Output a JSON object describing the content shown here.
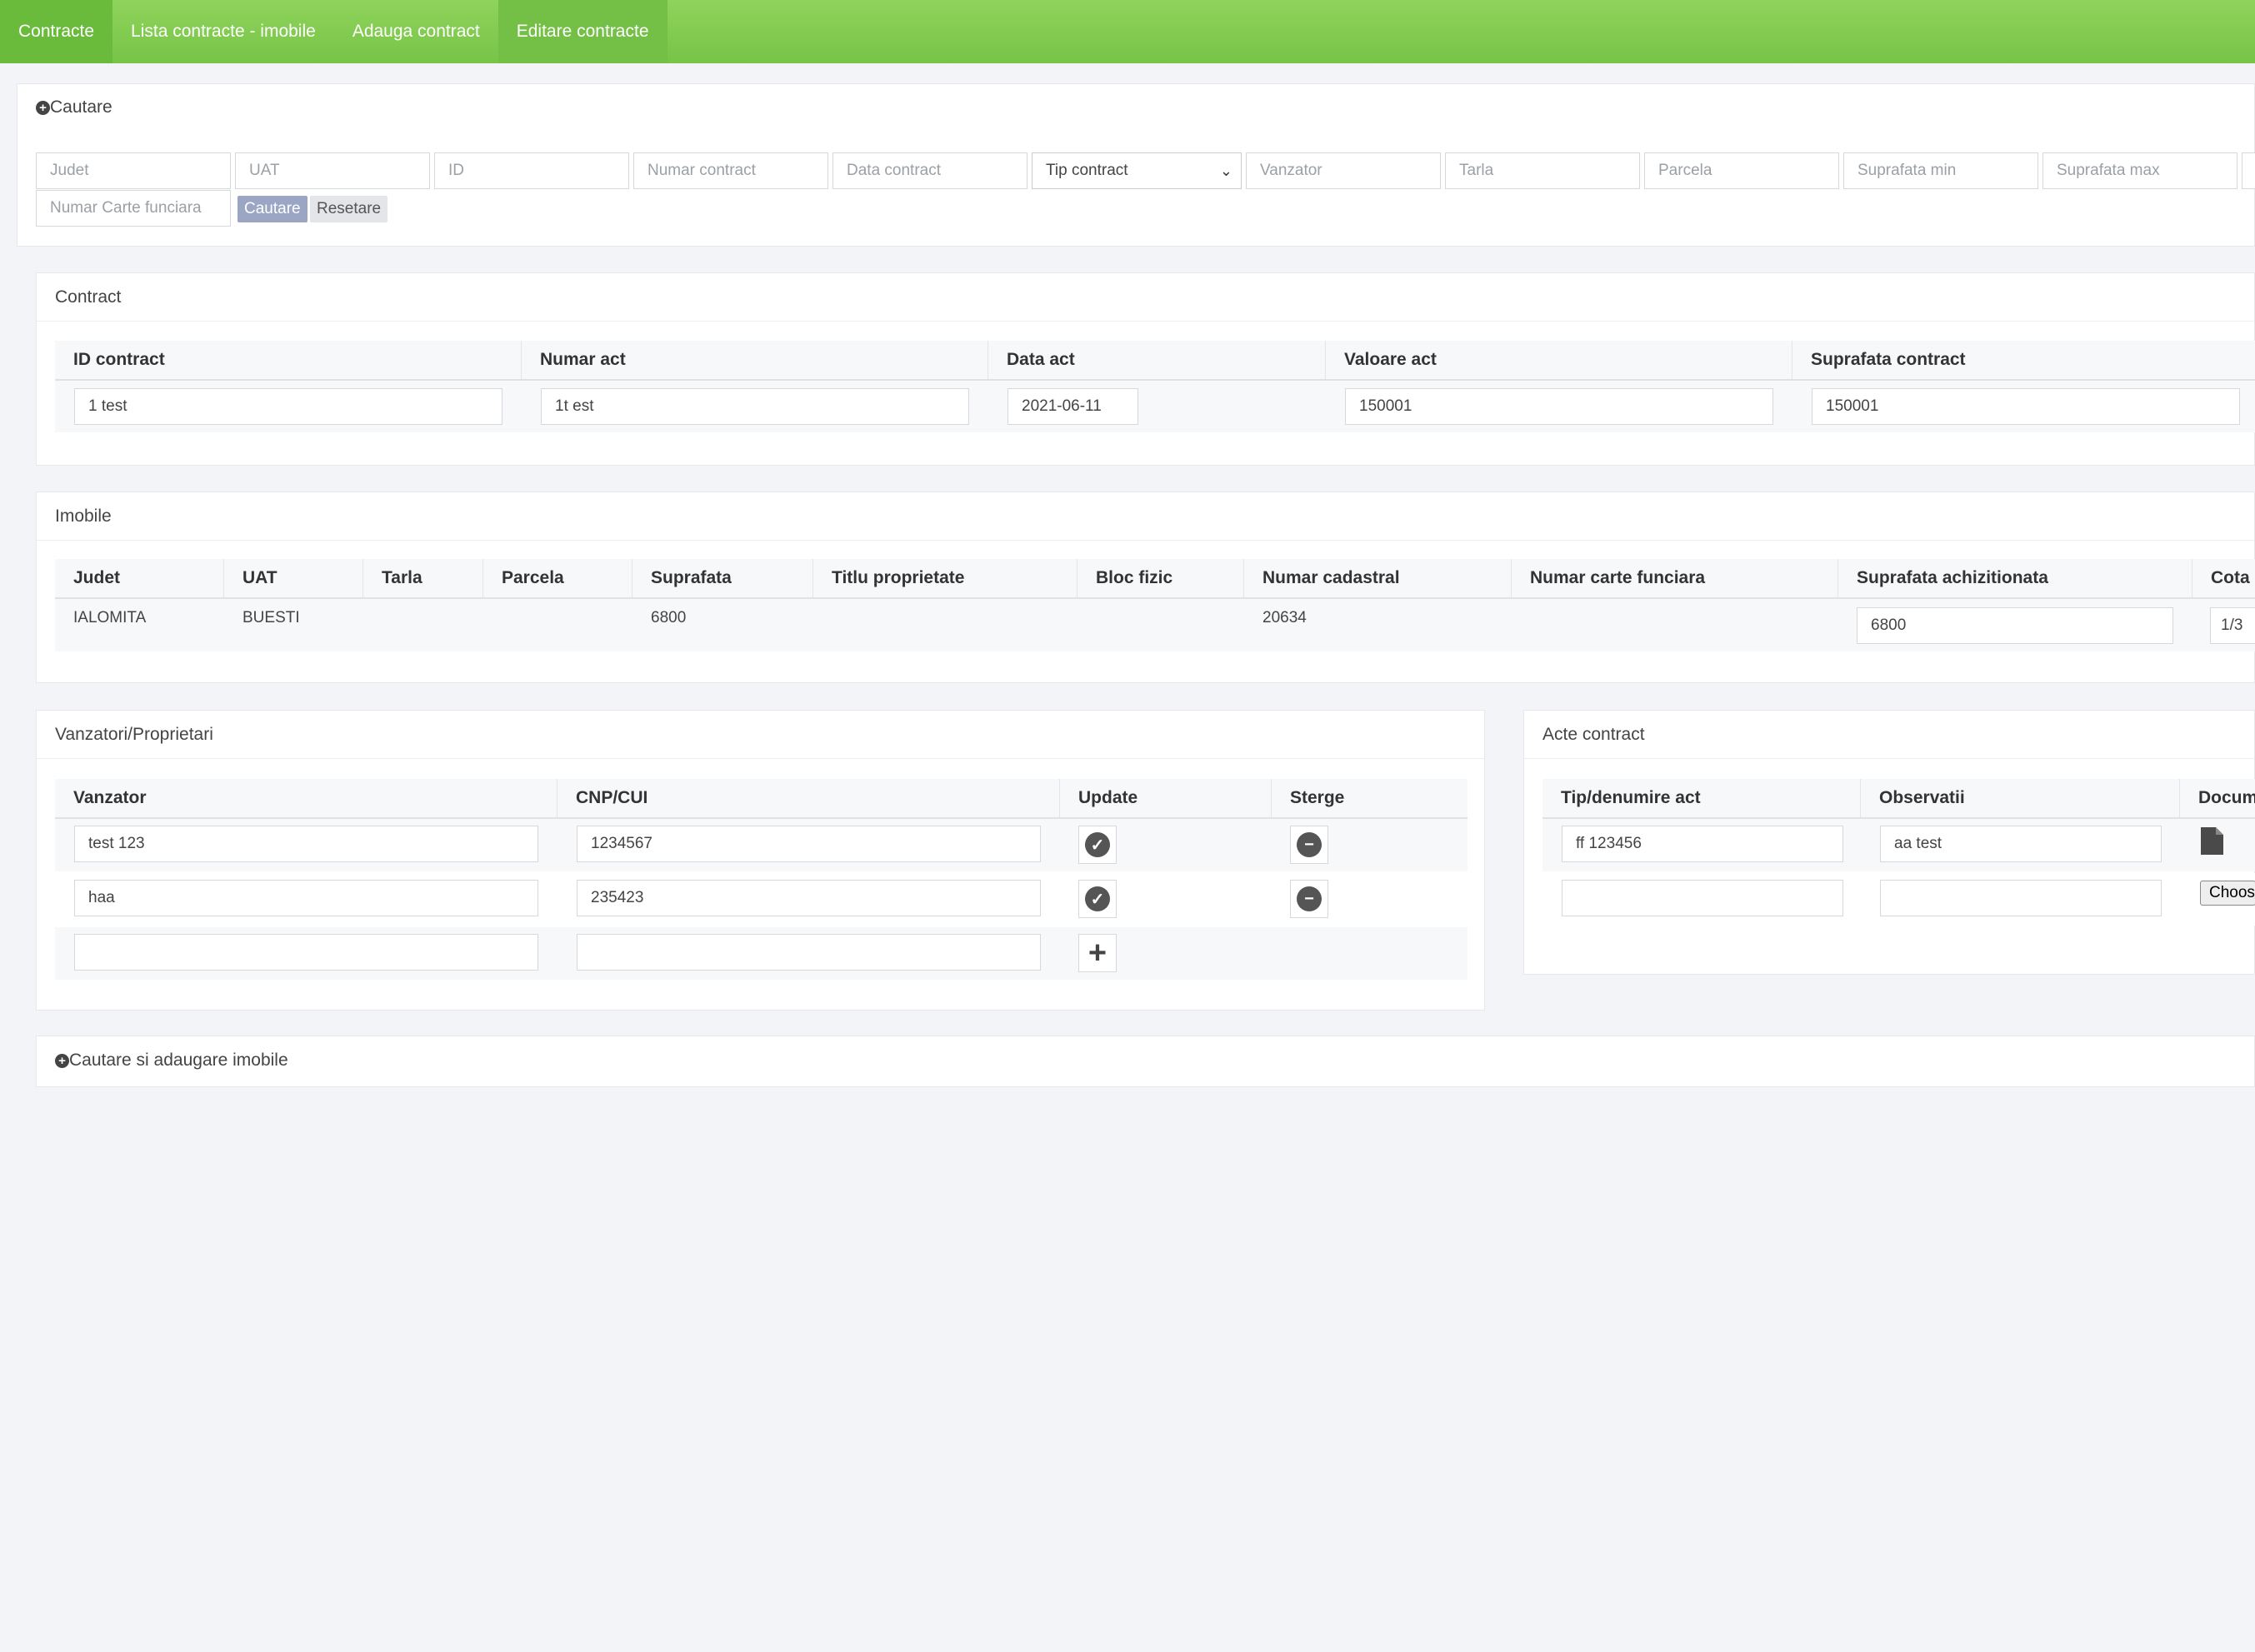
{
  "nav": {
    "items": [
      "Contracte",
      "Lista contracte - imobile",
      "Adauga contract",
      "Editare contracte"
    ]
  },
  "search": {
    "title": "Cautare",
    "placeholders": [
      "Judet",
      "UAT",
      "ID",
      "Numar contract",
      "Data contract",
      "Vanzator",
      "Tarla",
      "Parcela",
      "Suprafata min",
      "Suprafata max",
      "Numar Carte funciara"
    ],
    "tip_contract": "Tip contract",
    "search_label": "Cautare",
    "reset_label": "Resetare"
  },
  "contract": {
    "title": "Contract",
    "headers": [
      "ID contract",
      "Numar act",
      "Data act",
      "Valoare act",
      "Suprafata contract"
    ],
    "values": [
      "1 test",
      "1t est",
      "2021-06-11",
      "150001",
      "150001"
    ]
  },
  "imobile": {
    "title": "Imobile",
    "headers": [
      "Judet",
      "UAT",
      "Tarla",
      "Parcela",
      "Suprafata",
      "Titlu proprietate",
      "Bloc fizic",
      "Numar cadastral",
      "Numar carte funciara",
      "Suprafata achizitionata",
      "Cota"
    ],
    "row": {
      "judet": "IALOMITA",
      "uat": "BUESTI",
      "suprafata": "6800",
      "numar_cadastral": "20634",
      "suprafata_achizitionata": "6800",
      "cota": "1/3"
    }
  },
  "vanzatori": {
    "title": "Vanzatori/Proprietari",
    "headers": [
      "Vanzator",
      "CNP/CUI",
      "Update",
      "Sterge"
    ],
    "rows": [
      {
        "vanzator": "test 123",
        "cnp": "1234567"
      },
      {
        "vanzator": "haa",
        "cnp": "235423"
      }
    ]
  },
  "acte": {
    "title": "Acte contract",
    "headers": [
      "Tip/denumire act",
      "Observatii",
      "Docum"
    ],
    "rows": [
      {
        "tip": "ff 123456",
        "obs": "aa test"
      }
    ],
    "choose_label": "Choose File"
  },
  "cautare_imobile": {
    "title": "Cautare si adaugare imobile"
  }
}
